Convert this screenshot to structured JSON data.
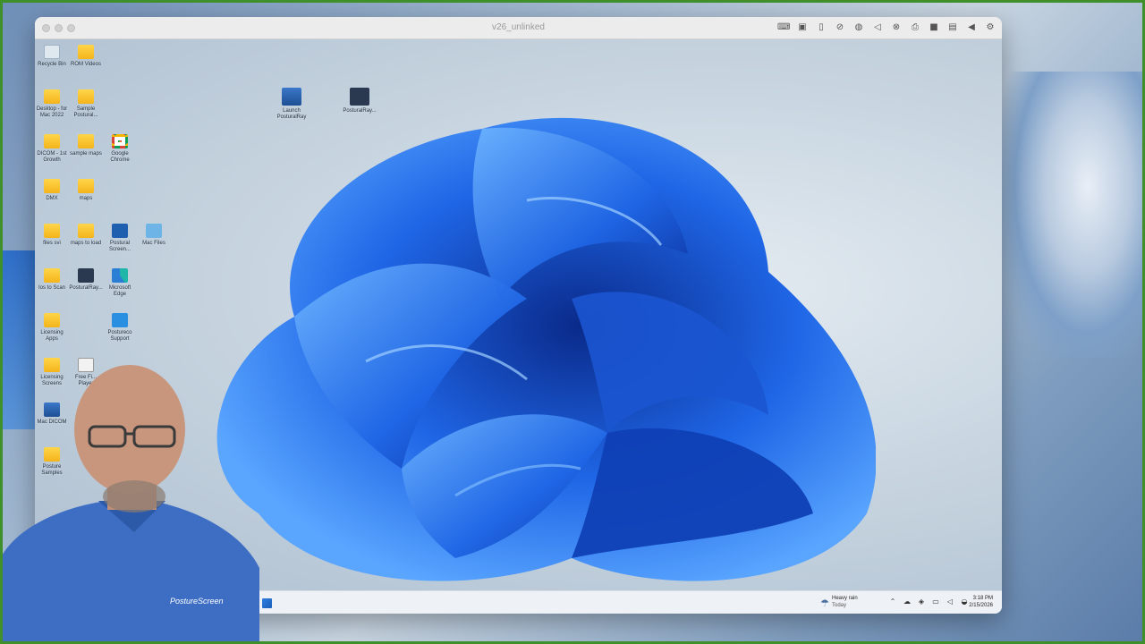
{
  "window": {
    "title": "v26_unlinked",
    "toolbar_icons": [
      "keyboard-icon",
      "cpu-icon",
      "usb-icon",
      "network-off-icon",
      "globe-icon",
      "volume-icon",
      "microphone-off-icon",
      "printer-icon",
      "camera-icon",
      "shared-folder-icon",
      "back-arrow-icon",
      "gear-icon"
    ]
  },
  "desktop_icons": [
    {
      "label": "Recycle Bin",
      "icon": "recycle-bin-icon"
    },
    {
      "label": "ROM Videos",
      "icon": "folder-icon"
    },
    {
      "label": "Desktop - for Mac 2022",
      "icon": "folder-icon"
    },
    {
      "label": "Sample Postural...",
      "icon": "folder-icon"
    },
    {
      "label": "DICOM - 1st Growth",
      "icon": "folder-icon"
    },
    {
      "label": "sample maps",
      "icon": "folder-icon"
    },
    {
      "label": "Google Chrome",
      "icon": "chrome-icon"
    },
    {
      "label": "DMX",
      "icon": "folder-icon"
    },
    {
      "label": "maps",
      "icon": "folder-icon"
    },
    {
      "label": "files svi",
      "icon": "folder-icon"
    },
    {
      "label": "maps to load",
      "icon": "folder-icon"
    },
    {
      "label": "Postural Screen...",
      "icon": "support-icon"
    },
    {
      "label": "Mac Files",
      "icon": "mac-folder-icon"
    },
    {
      "label": "Ios to Scan",
      "icon": "folder-icon"
    },
    {
      "label": "PosturalRay...",
      "icon": "posturalray-icon"
    },
    {
      "label": "Microsoft Edge",
      "icon": "edge-icon"
    },
    {
      "label": "Licensing Apps",
      "icon": "folder-icon"
    },
    {
      "label": "Postureco Support",
      "icon": "support-icon"
    },
    {
      "label": "Licensing Screens",
      "icon": "folder-icon"
    },
    {
      "label": "Free Fi... Player",
      "icon": "media-player-icon"
    },
    {
      "label": "Mac DICOM",
      "icon": "dicom-icon"
    },
    {
      "label": "Posture Samples",
      "icon": "folder-icon"
    },
    {
      "label": "Launch PosturalRay",
      "icon": "launch-app-icon"
    },
    {
      "label": "PosturalRay...",
      "icon": "posturalray-icon"
    }
  ],
  "taskbar": {
    "weather_title": "Heavy rain",
    "weather_sub": "Today",
    "time": "3:18 PM",
    "date": "2/15/2026",
    "tray_icons": [
      "chevron-up-icon",
      "onedrive-icon",
      "security-icon",
      "display-icon",
      "speaker-icon",
      "network-icon"
    ]
  },
  "presenter": {
    "shirt_logo": "PostureScreen"
  },
  "colors": {
    "frame_green": "#3f8f2a",
    "bloom_blue": "#1f66e6",
    "shirt_blue": "#3d6ec4"
  }
}
